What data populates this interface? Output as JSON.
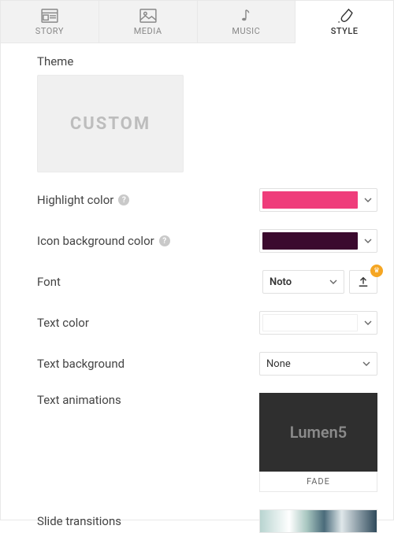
{
  "tabs": [
    {
      "label": "STORY"
    },
    {
      "label": "MEDIA"
    },
    {
      "label": "MUSIC"
    },
    {
      "label": "STYLE"
    }
  ],
  "theme": {
    "section_label": "Theme",
    "swatch_label": "CUSTOM"
  },
  "rows": {
    "highlight": {
      "label": "Highlight color",
      "color": "#ef3d7b"
    },
    "iconbg": {
      "label": "Icon background color",
      "color": "#3b0a2e"
    },
    "font": {
      "label": "Font",
      "value": "Noto"
    },
    "textcolor": {
      "label": "Text color",
      "color": "#ffffff"
    },
    "textbg": {
      "label": "Text background",
      "value": "None"
    },
    "anim": {
      "label": "Text animations",
      "preview_text": "Lumen5",
      "caption": "FADE"
    },
    "trans": {
      "label": "Slide transitions"
    }
  },
  "glyphs": {
    "help": "?",
    "crown": "♛"
  }
}
